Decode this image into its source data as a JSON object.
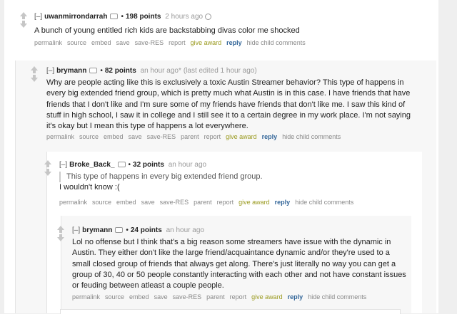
{
  "comments": [
    {
      "toggle": "[–]",
      "author": "uwanmirrondarrah",
      "score": "198 points",
      "time": "2 hours ago",
      "edited": "",
      "quote": "",
      "paragraphs": [
        "A bunch of young entitled rich kids are backstabbing divas color me shocked"
      ],
      "actions": [
        "permalink",
        "source",
        "embed",
        "save",
        "save-RES",
        "report",
        "give award",
        "reply",
        "hide child comments"
      ]
    },
    {
      "toggle": "[–]",
      "author": "brymann",
      "score": "82 points",
      "time": "an hour ago*",
      "edited": "(last edited 1 hour ago)",
      "quote": "",
      "paragraphs": [
        "Why are people acting like this is exclusively a toxic Austin Streamer behavior? This type of        happens in every big extended friend group, which is pretty much what Austin is in this case. I have friends that have friends that I don't like and I'm sure some of my friends have friends that don't like me. I saw this kind of stuff in high school, I saw it in college and I still see it to a certain degree in my work place. I'm not saying it's okay but I mean this type of        happens a lot everywhere."
      ],
      "actions": [
        "permalink",
        "source",
        "embed",
        "save",
        "save-RES",
        "parent",
        "report",
        "give award",
        "reply",
        "hide child comments"
      ]
    },
    {
      "toggle": "[–]",
      "author": "Broke_Back_",
      "score": "32 points",
      "time": "an hour ago",
      "edited": "",
      "quote": "This type of        happens in every big extended friend group.",
      "paragraphs": [
        "I wouldn't know :("
      ],
      "actions": [
        "permalink",
        "source",
        "embed",
        "save",
        "save-RES",
        "parent",
        "report",
        "give award",
        "reply",
        "hide child comments"
      ]
    },
    {
      "toggle": "[–]",
      "author": "brymann",
      "score": "24 points",
      "time": "an hour ago",
      "edited": "",
      "quote": "",
      "paragraphs": [
        "Lol no offense but I think that's a big reason some streamers have issue with the dynamic in Austin. They either don't like the large friend/acquaintance dynamic and/or they're used to a small closed group of friends that always get along. There's just literally no way you can get a group of 30, 40 or 50 people constantly interacting with each other and not have constant issues or feuding between atleast a couple people."
      ],
      "actions": [
        "permalink",
        "source",
        "embed",
        "save",
        "save-RES",
        "parent",
        "report",
        "give award",
        "reply",
        "hide child comments"
      ]
    }
  ],
  "colors": {
    "background": "#efefef",
    "give_award": "#9a9a1f",
    "reply": "#336699",
    "meta": "#888888"
  }
}
